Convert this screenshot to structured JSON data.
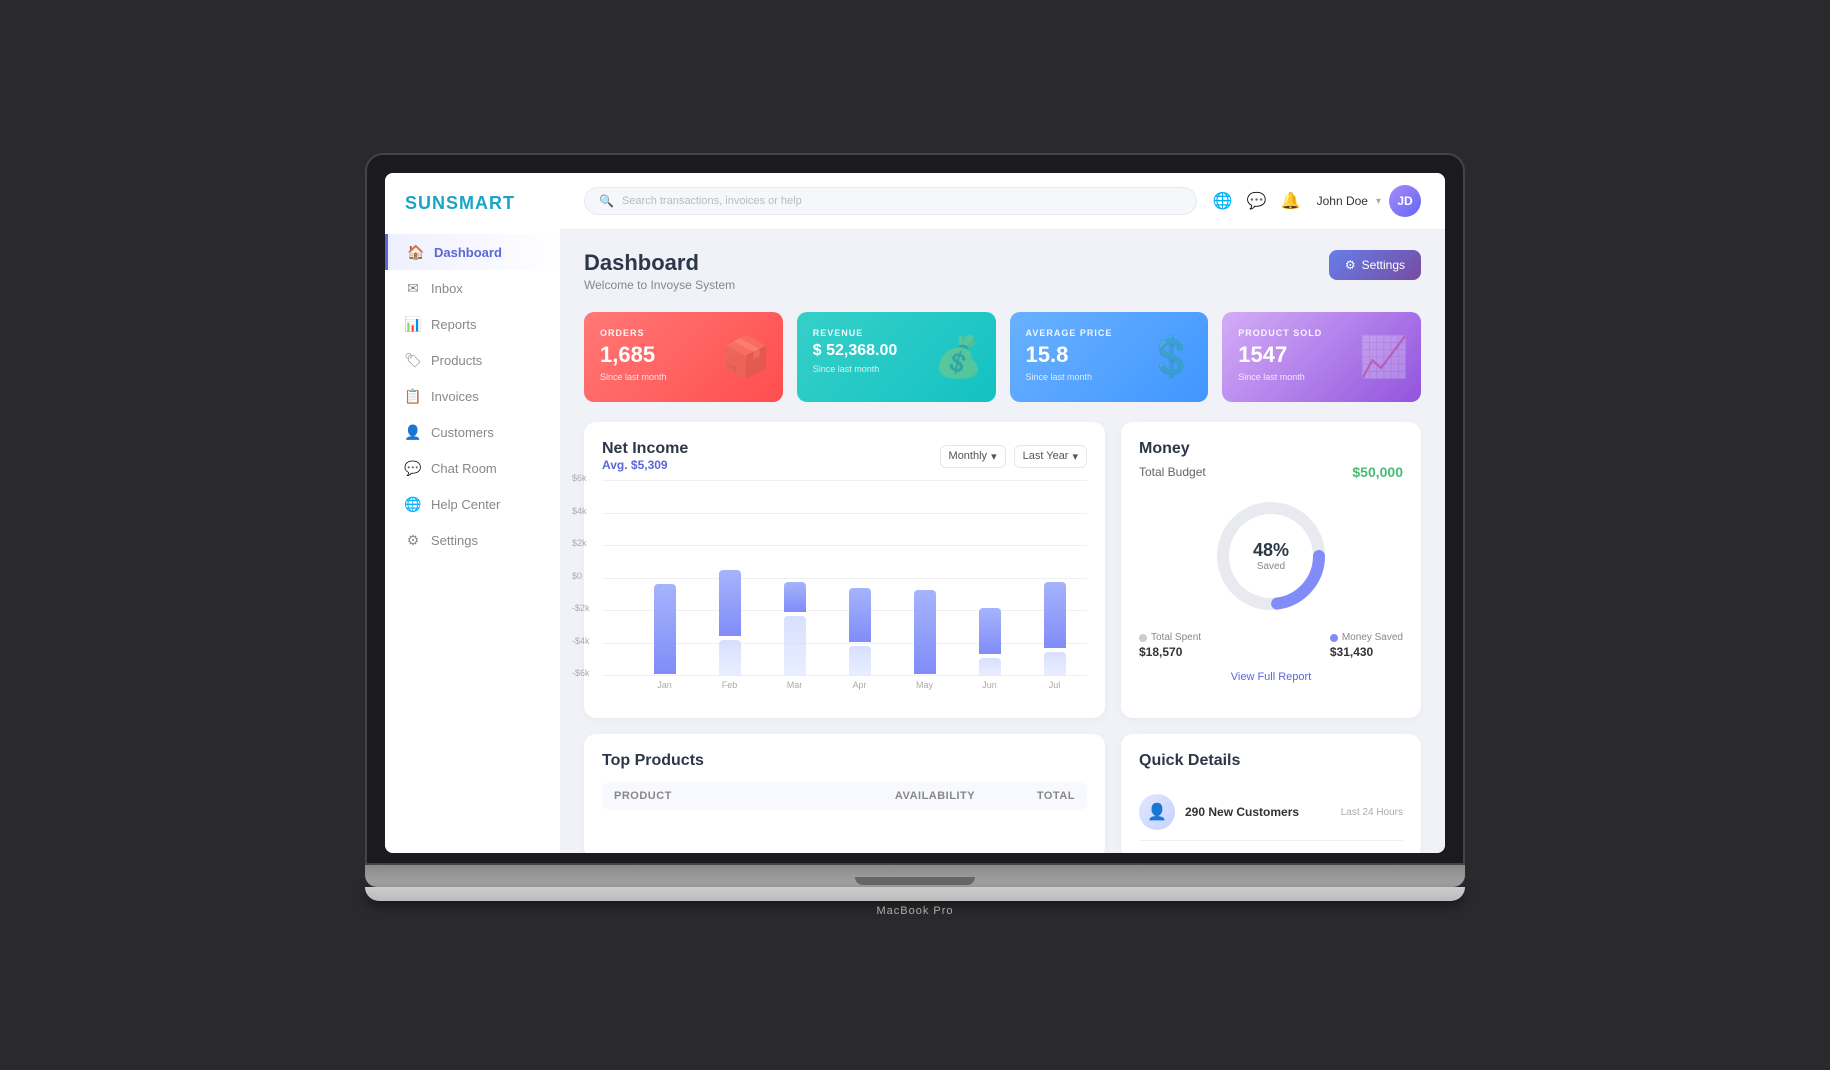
{
  "app": {
    "name": "SUNSMART"
  },
  "header": {
    "search_placeholder": "Search transactions, invoices or help",
    "user_name": "John Doe",
    "settings_label": "Settings"
  },
  "sidebar": {
    "items": [
      {
        "id": "dashboard",
        "label": "Dashboard",
        "icon": "🏠",
        "active": true
      },
      {
        "id": "inbox",
        "label": "Inbox",
        "icon": "✉"
      },
      {
        "id": "reports",
        "label": "Reports",
        "icon": "📊"
      },
      {
        "id": "products",
        "label": "Products",
        "icon": "🏷"
      },
      {
        "id": "invoices",
        "label": "Invoices",
        "icon": "📋"
      },
      {
        "id": "customers",
        "label": "Customers",
        "icon": "👤"
      },
      {
        "id": "chatroom",
        "label": "Chat Room",
        "icon": "💬"
      },
      {
        "id": "helpcenter",
        "label": "Help Center",
        "icon": "🌐"
      },
      {
        "id": "settings",
        "label": "Settings",
        "icon": "⚙"
      }
    ]
  },
  "page": {
    "title": "Dashboard",
    "subtitle": "Welcome to Invoyse System"
  },
  "stats": [
    {
      "id": "orders",
      "label": "ORDERS",
      "value": "1,685",
      "since": "Since last month",
      "icon": "📦",
      "class": "orders"
    },
    {
      "id": "revenue",
      "label": "REVENUE",
      "value": "$ 52,368.00",
      "since": "Since last month",
      "icon": "💰",
      "class": "revenue"
    },
    {
      "id": "avg",
      "label": "AVERAGE PRICE",
      "value": "15.8",
      "since": "Since last month",
      "icon": "💲",
      "class": "avg"
    },
    {
      "id": "sold",
      "label": "PRODUCT SOLD",
      "value": "1547",
      "since": "Since last month",
      "icon": "📈",
      "class": "sold"
    }
  ],
  "net_income": {
    "title": "Net Income",
    "avg_label": "Avg. $5,309",
    "filter_period": "Monthly",
    "filter_year": "Last Year",
    "bars": [
      {
        "month": "Jan",
        "positive": 75,
        "negative": 0
      },
      {
        "month": "Feb",
        "positive": 55,
        "negative": 30
      },
      {
        "month": "Mar",
        "positive": 25,
        "negative": 50
      },
      {
        "month": "Apr",
        "positive": 45,
        "negative": 25
      },
      {
        "month": "May",
        "positive": 70,
        "negative": 0
      },
      {
        "month": "Jun",
        "positive": 38,
        "negative": 15
      },
      {
        "month": "Jul",
        "positive": 55,
        "negative": 20
      }
    ],
    "y_labels": [
      "$6k",
      "$4k",
      "$2k",
      "$0",
      "-$2k",
      "-$4k",
      "-$6k"
    ]
  },
  "money": {
    "title": "Money",
    "total_budget_label": "Total Budget",
    "total_budget_value": "$50,000",
    "donut_pct": "48%",
    "donut_sub": "Saved",
    "total_spent_label": "Total Spent",
    "total_spent_value": "$18,570",
    "money_saved_label": "Money Saved",
    "money_saved_value": "$31,430",
    "view_report": "View Full Report"
  },
  "top_products": {
    "title": "Top Products",
    "columns": [
      "Product",
      "Availability",
      "Total"
    ]
  },
  "quick_details": {
    "title": "Quick Details",
    "items": [
      {
        "icon": "👤",
        "title": "290 New Customers",
        "time": "Last 24 Hours"
      }
    ]
  },
  "macbook_label": "MacBook Pro"
}
